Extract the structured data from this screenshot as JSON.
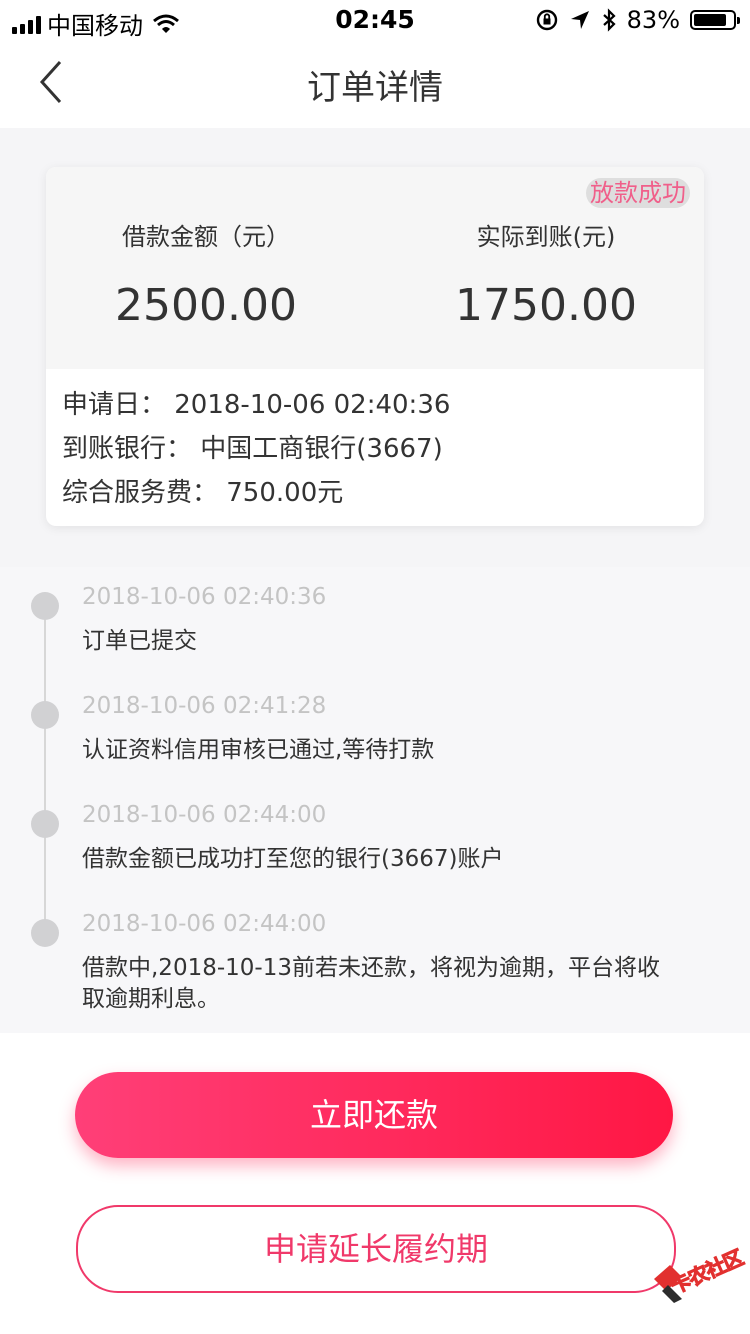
{
  "status_bar": {
    "carrier": "中国移动",
    "time": "02:45",
    "battery": "83%",
    "battery_level": 0.83
  },
  "nav": {
    "title": "订单详情"
  },
  "summary": {
    "badge": "放款成功",
    "loan_amount_label": "借款金额（元）",
    "loan_amount": "2500.00",
    "received_label": "实际到账(元)",
    "received_amount": "1750.00",
    "apply_date": "申请日：  2018-10-06 02:40:36",
    "bank": "到账银行：  中国工商银行(3667)",
    "service_fee": "综合服务费：  750.00元"
  },
  "timeline": [
    {
      "time": "2018-10-06 02:40:36",
      "text": "订单已提交"
    },
    {
      "time": "2018-10-06 02:41:28",
      "text": "认证资料信用审核已通过,等待打款"
    },
    {
      "time": "2018-10-06 02:44:00",
      "text": "借款金额已成功打至您的银行(3667)账户"
    },
    {
      "time": "2018-10-06 02:44:00",
      "text": "借款中,2018-10-13前若未还款，将视为逾期，平台将收取逾期利息。"
    }
  ],
  "actions": {
    "repay": "立即还款",
    "extend": "申请延长履约期"
  },
  "watermark": "卡农社区"
}
